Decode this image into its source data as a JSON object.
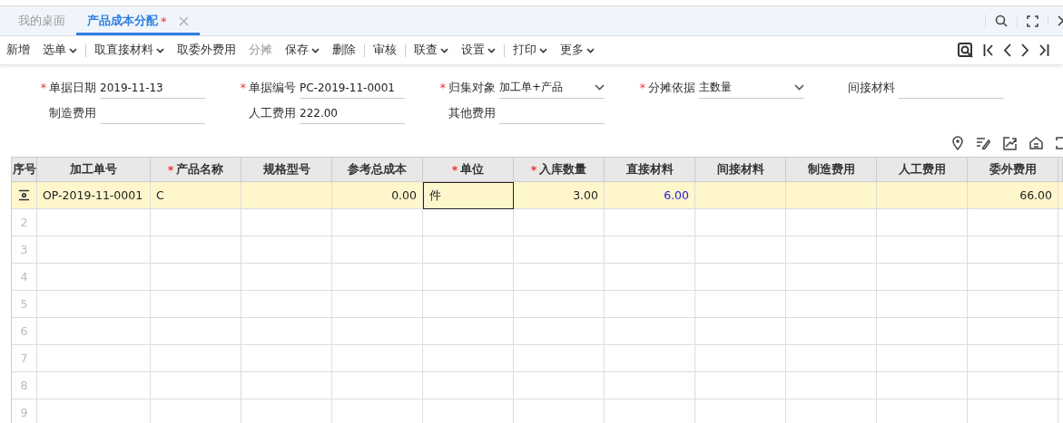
{
  "tabs": [
    {
      "label": "我的桌面",
      "selected": false,
      "closable": false
    },
    {
      "label": "产品成本分配",
      "selected": true,
      "modified_mark": "*",
      "closable": true
    }
  ],
  "toolbar": [
    {
      "kind": "button",
      "label": "新增",
      "dropdown": false,
      "disabled": false
    },
    {
      "kind": "button",
      "label": "选单",
      "dropdown": true,
      "disabled": false
    },
    {
      "kind": "divider"
    },
    {
      "kind": "button",
      "label": "取直接材料",
      "dropdown": true,
      "disabled": false
    },
    {
      "kind": "button",
      "label": "取委外费用",
      "dropdown": false,
      "disabled": false
    },
    {
      "kind": "button",
      "label": "分摊",
      "dropdown": false,
      "disabled": true
    },
    {
      "kind": "button",
      "label": "保存",
      "dropdown": true,
      "disabled": false
    },
    {
      "kind": "button",
      "label": "删除",
      "dropdown": false,
      "disabled": false
    },
    {
      "kind": "divider"
    },
    {
      "kind": "button",
      "label": "审核",
      "dropdown": false,
      "disabled": false
    },
    {
      "kind": "divider"
    },
    {
      "kind": "button",
      "label": "联查",
      "dropdown": true,
      "disabled": false
    },
    {
      "kind": "button",
      "label": "设置",
      "dropdown": true,
      "disabled": false
    },
    {
      "kind": "divider"
    },
    {
      "kind": "button",
      "label": "打印",
      "dropdown": true,
      "disabled": false
    },
    {
      "kind": "button",
      "label": "更多",
      "dropdown": true,
      "disabled": false
    }
  ],
  "form_rows": [
    [
      {
        "label": "单据日期",
        "required_mark": "*",
        "kind": "text",
        "value": "2019-11-13"
      },
      {
        "label": "单据编号",
        "required_mark": "*",
        "kind": "text",
        "value": "PC-2019-11-0001"
      },
      {
        "label": "归集对象",
        "required_mark": "*",
        "kind": "select",
        "value": "加工单+产品"
      },
      {
        "label": "分摊依据",
        "required_mark": "*",
        "kind": "select",
        "value": "主数量"
      },
      {
        "label": "间接材料",
        "kind": "text"
      }
    ],
    [
      {
        "label": "制造费用",
        "kind": "text"
      },
      {
        "label": "人工费用",
        "kind": "text",
        "value": "222.00"
      },
      {
        "label": "其他费用",
        "kind": "text"
      }
    ]
  ],
  "table": {
    "columns": [
      {
        "label": "序号"
      },
      {
        "label": "加工单号"
      },
      {
        "label": "产品名称",
        "required_mark": "*"
      },
      {
        "label": "规格型号"
      },
      {
        "label": "参考总成本"
      },
      {
        "label": "单位",
        "required_mark": "*"
      },
      {
        "label": "入库数量",
        "required_mark": "*"
      },
      {
        "label": "直接材料"
      },
      {
        "label": "间接材料"
      },
      {
        "label": "制造费用"
      },
      {
        "label": "人工费用"
      },
      {
        "label": "委外费用"
      }
    ],
    "rows": [
      {
        "kind": "current",
        "selected": true,
        "order_no": "OP-2019-11-0001",
        "product_name": "C",
        "ref_total_cost": "0.00",
        "unit": {
          "text": "件",
          "focused": true
        },
        "in_qty": "3.00",
        "direct_material": {
          "text": "6.00",
          "link": true
        },
        "outsourcing_cost": "66.00"
      },
      {
        "kind": "number",
        "number": "2",
        "selected": false
      },
      {
        "kind": "number",
        "number": "3",
        "selected": false
      },
      {
        "kind": "number",
        "number": "4",
        "selected": false
      },
      {
        "kind": "number",
        "number": "5",
        "selected": false
      },
      {
        "kind": "number",
        "number": "6",
        "selected": false
      },
      {
        "kind": "number",
        "number": "7",
        "selected": false
      },
      {
        "kind": "number",
        "number": "8",
        "selected": false
      },
      {
        "kind": "number",
        "number": "9",
        "selected": false
      }
    ]
  }
}
